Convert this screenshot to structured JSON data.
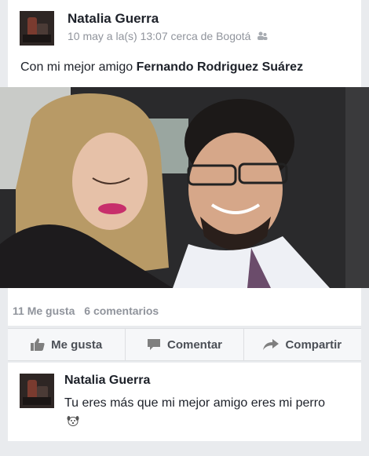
{
  "post": {
    "author": "Natalia Guerra",
    "timestamp": "10 may a la(s) 13:07 cerca de Bogotá",
    "privacy_icon": "friends-icon",
    "text_prefix": "Con mi mejor amigo",
    "tagged_friend": "Fernando Rodriguez Suárez",
    "photo_description": "selfie"
  },
  "stats": {
    "likes": "11 Me gusta",
    "comments": "6 comentarios"
  },
  "actions": {
    "like": "Me gusta",
    "comment": "Comentar",
    "share": "Compartir"
  },
  "comment": {
    "author": "Natalia Guerra",
    "text": "Tu eres más que mi mejor amigo eres mi perro"
  },
  "colors": {
    "background": "#e9ebee",
    "card": "#ffffff",
    "meta_gray": "#90949c",
    "action_gray": "#4b4f56"
  }
}
